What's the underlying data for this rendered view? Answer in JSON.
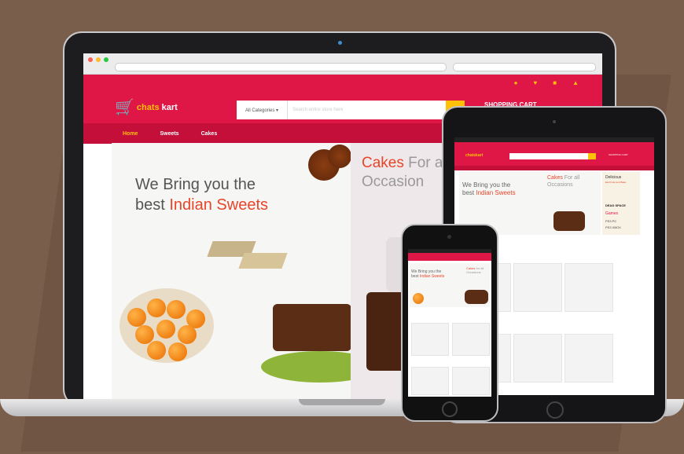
{
  "brand": {
    "cart_symbol": "🛒",
    "name_part1": "chats",
    "name_part2": "kart"
  },
  "search": {
    "category_label": "All Categories ▾",
    "placeholder": "Search entire store here"
  },
  "header": {
    "cart_label": "SHOPPING CART",
    "icons": [
      "user-icon",
      "heart-icon",
      "gift-icon",
      "lock-icon"
    ]
  },
  "nav": {
    "items": [
      "Home",
      "Sweets",
      "Cakes"
    ]
  },
  "hero": {
    "line1": "We Bring you the",
    "line2_prefix": "best ",
    "line2_highlight": "Indian Sweets"
  },
  "hero2": {
    "line1_highlight": "Cakes",
    "line1_rest": " For a",
    "line2": "Occasion"
  },
  "tablet": {
    "hero_line1": "We Bring you the",
    "hero_line2_prefix": "best ",
    "hero_line2_highlight": "Indian Sweets",
    "cakes_highlight": "Cakes",
    "cakes_rest": " For all",
    "cakes_line2": "Occasions",
    "side_title": "Delicious",
    "side_subtitle": "Eat Fruits and Bake",
    "game1": "DEAD SPACE",
    "game2": "Games",
    "game3": "PS3 PC",
    "game4": "PS3 XBOX",
    "cart_label": "SHOPPING CART"
  },
  "phone": {
    "hero_line1": "We Bring you the",
    "hero_line2_prefix": "best ",
    "hero_line2_highlight": "Indian Sweets",
    "cakes_highlight": "Cakes",
    "cakes_rest": " for all",
    "cakes_line2": "Occasions"
  },
  "colors": {
    "brand_red": "#de1746",
    "accent_yellow": "#ffc107",
    "background": "#7a5e4c"
  }
}
